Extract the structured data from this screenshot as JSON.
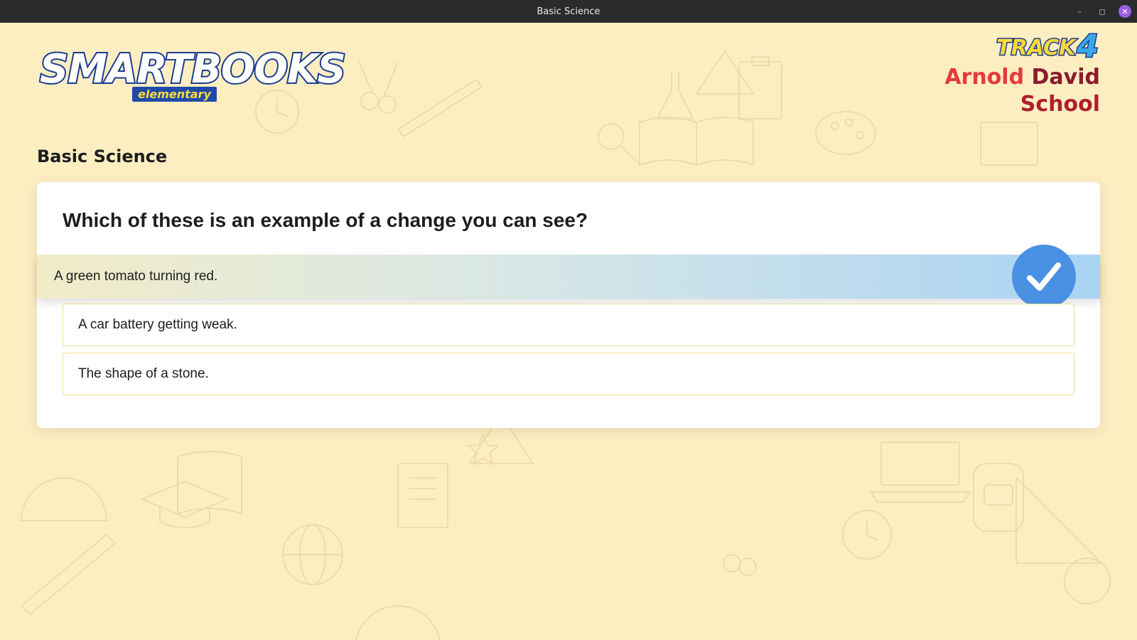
{
  "window": {
    "title": "Basic Science",
    "minimize": "–",
    "maximize": "◻",
    "close": "✕"
  },
  "logo": {
    "main": "SMARTBOOKS",
    "sub": "elementary"
  },
  "track": {
    "word": "TRACK",
    "number": "4"
  },
  "school": {
    "name_word1": "Arnold",
    "name_word2": "David",
    "name_line2": "School"
  },
  "subject": "Basic Science",
  "quiz": {
    "question": "Which of these is an example of a change you can see?",
    "options": [
      {
        "label": "A green tomato turning red.",
        "selected": true
      },
      {
        "label": "A car battery getting weak.",
        "selected": false
      },
      {
        "label": "The shape of a stone.",
        "selected": false
      }
    ]
  },
  "colors": {
    "background": "#fdeec2",
    "check": "#4a90e2",
    "selected_gradient_end": "#a9d3f4",
    "option_border": "#f1dc8a"
  },
  "icons": {
    "check": "check-icon",
    "close": "close-icon"
  }
}
